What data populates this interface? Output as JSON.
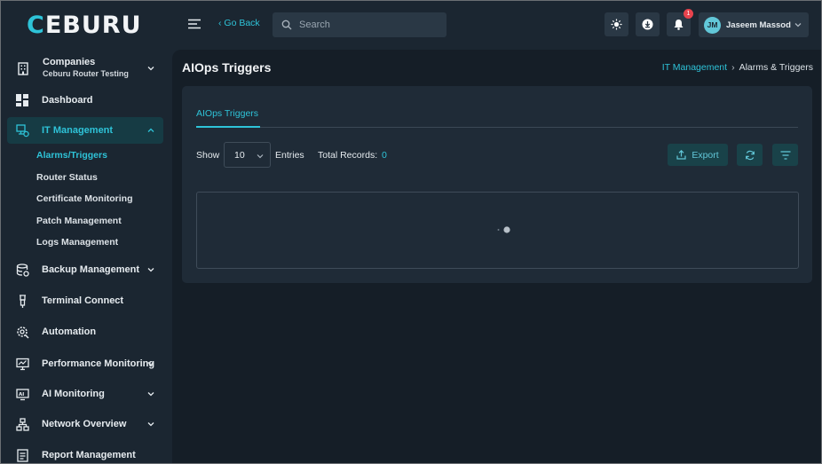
{
  "app": {
    "logo_text": "CEBURU",
    "accent_color": "#2ec3d8"
  },
  "sidebar": {
    "company": {
      "label": "Companies",
      "selected": "Ceburu Router Testing",
      "icon": "building-icon"
    },
    "items": [
      {
        "label": "Dashboard",
        "icon": "dashboard-icon"
      },
      {
        "label": "IT Management",
        "icon": "it-management-icon",
        "active": true,
        "expanded": true,
        "children": [
          "Alarms/Triggers",
          "Router Status",
          "Certificate Monitoring",
          "Patch Management",
          "Logs Management"
        ]
      },
      {
        "label": "Backup Management",
        "icon": "database-icon"
      },
      {
        "label": "Terminal Connect",
        "icon": "terminal-icon"
      },
      {
        "label": "Automation",
        "icon": "automation-icon"
      },
      {
        "label": "Performance Monitoring",
        "icon": "monitor-chart-icon"
      },
      {
        "label": "AI Monitoring",
        "icon": "ai-monitor-icon"
      },
      {
        "label": "Network Overview",
        "icon": "network-icon"
      },
      {
        "label": "Report Management",
        "icon": "report-icon"
      }
    ]
  },
  "topbar": {
    "go_back": "‹ Go Back",
    "search_placeholder": "Search",
    "notification_count": "1",
    "user": {
      "initials": "JM",
      "name": "Jaseem Massod"
    }
  },
  "main": {
    "title": "AIOps Triggers",
    "breadcrumb": {
      "link": "IT Management",
      "separator": "›",
      "current": "Alarms & Triggers"
    },
    "tab": "AIOps Triggers",
    "controls": {
      "show_label": "Show",
      "entries_value": "10",
      "entries_label": "Entries",
      "total_label": "Total Records:",
      "total_value": "0",
      "export_label": "Export"
    }
  }
}
